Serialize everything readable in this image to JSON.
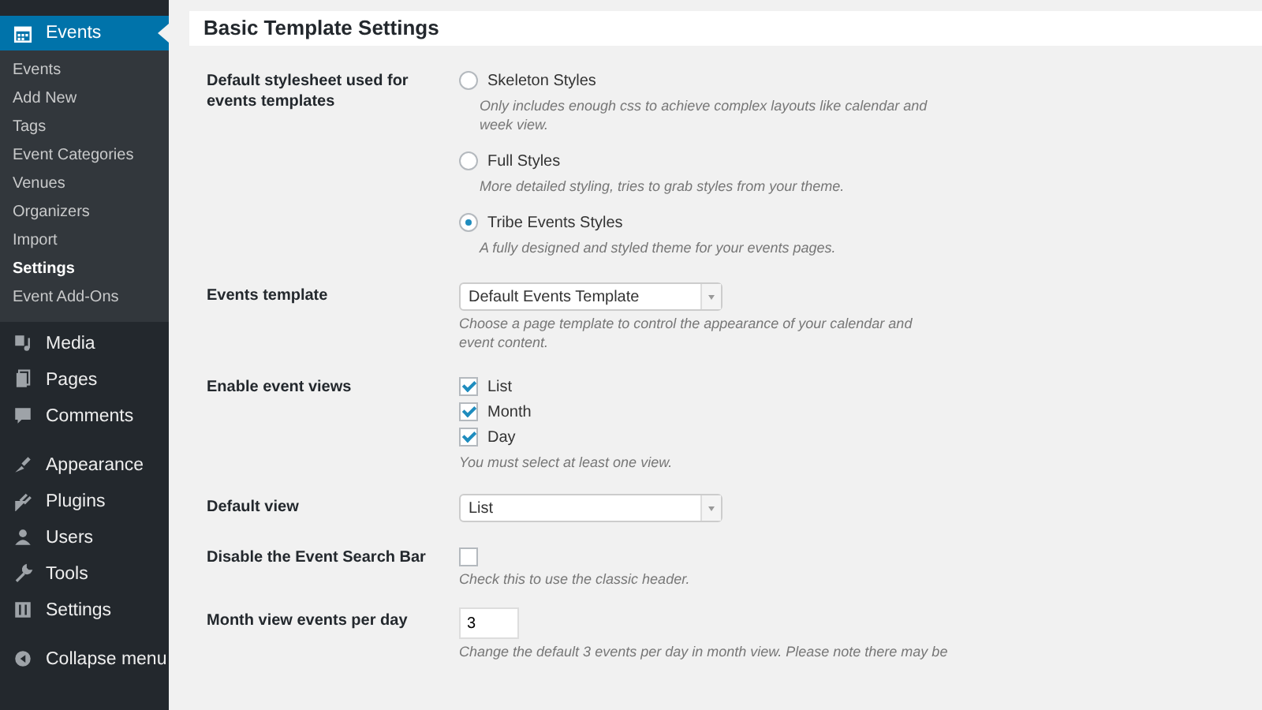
{
  "sidebar": {
    "items": [
      {
        "label": "Events",
        "selected": true,
        "children": [
          {
            "label": "Events",
            "selected": false
          },
          {
            "label": "Add New",
            "selected": false
          },
          {
            "label": "Tags",
            "selected": false
          },
          {
            "label": "Event Categories",
            "selected": false
          },
          {
            "label": "Venues",
            "selected": false
          },
          {
            "label": "Organizers",
            "selected": false
          },
          {
            "label": "Import",
            "selected": false
          },
          {
            "label": "Settings",
            "selected": true
          },
          {
            "label": "Event Add-Ons",
            "selected": false
          }
        ]
      },
      {
        "label": "Media",
        "selected": false
      },
      {
        "label": "Pages",
        "selected": false
      },
      {
        "label": "Comments",
        "selected": false
      },
      {
        "label": "Appearance",
        "selected": false
      },
      {
        "label": "Plugins",
        "selected": false
      },
      {
        "label": "Users",
        "selected": false
      },
      {
        "label": "Tools",
        "selected": false
      },
      {
        "label": "Settings",
        "selected": false
      },
      {
        "label": "Collapse menu",
        "selected": false
      }
    ]
  },
  "section_title": "Basic Template Settings",
  "settings": [
    {
      "kind": "radio_group",
      "label": "Default stylesheet used for events templates",
      "options": [
        {
          "label": "Skeleton Styles",
          "description": "Only includes enough css to achieve complex layouts like calendar and week view.",
          "selected": false
        },
        {
          "label": "Full Styles",
          "description": "More detailed styling, tries to grab styles from your theme.",
          "selected": false
        },
        {
          "label": "Tribe Events Styles",
          "description": "A fully designed and styled theme for your events pages.",
          "selected": true
        }
      ]
    },
    {
      "kind": "select",
      "label": "Events template",
      "value": "Default Events Template",
      "help": "Choose a page template to control the appearance of your calendar and event content."
    },
    {
      "kind": "checkbox_group",
      "label": "Enable event views",
      "options": [
        {
          "label": "List",
          "checked": true
        },
        {
          "label": "Month",
          "checked": true
        },
        {
          "label": "Day",
          "checked": true
        }
      ],
      "help": "You must select at least one view."
    },
    {
      "kind": "select",
      "label": "Default view",
      "value": "List"
    },
    {
      "kind": "checkbox",
      "label": "Disable the Event Search Bar",
      "checked": false,
      "help": "Check this to use the classic header."
    },
    {
      "kind": "number",
      "label": "Month view events per day",
      "value": "3",
      "help": "Change the default 3 events per day in month view. Please note there may be"
    }
  ]
}
